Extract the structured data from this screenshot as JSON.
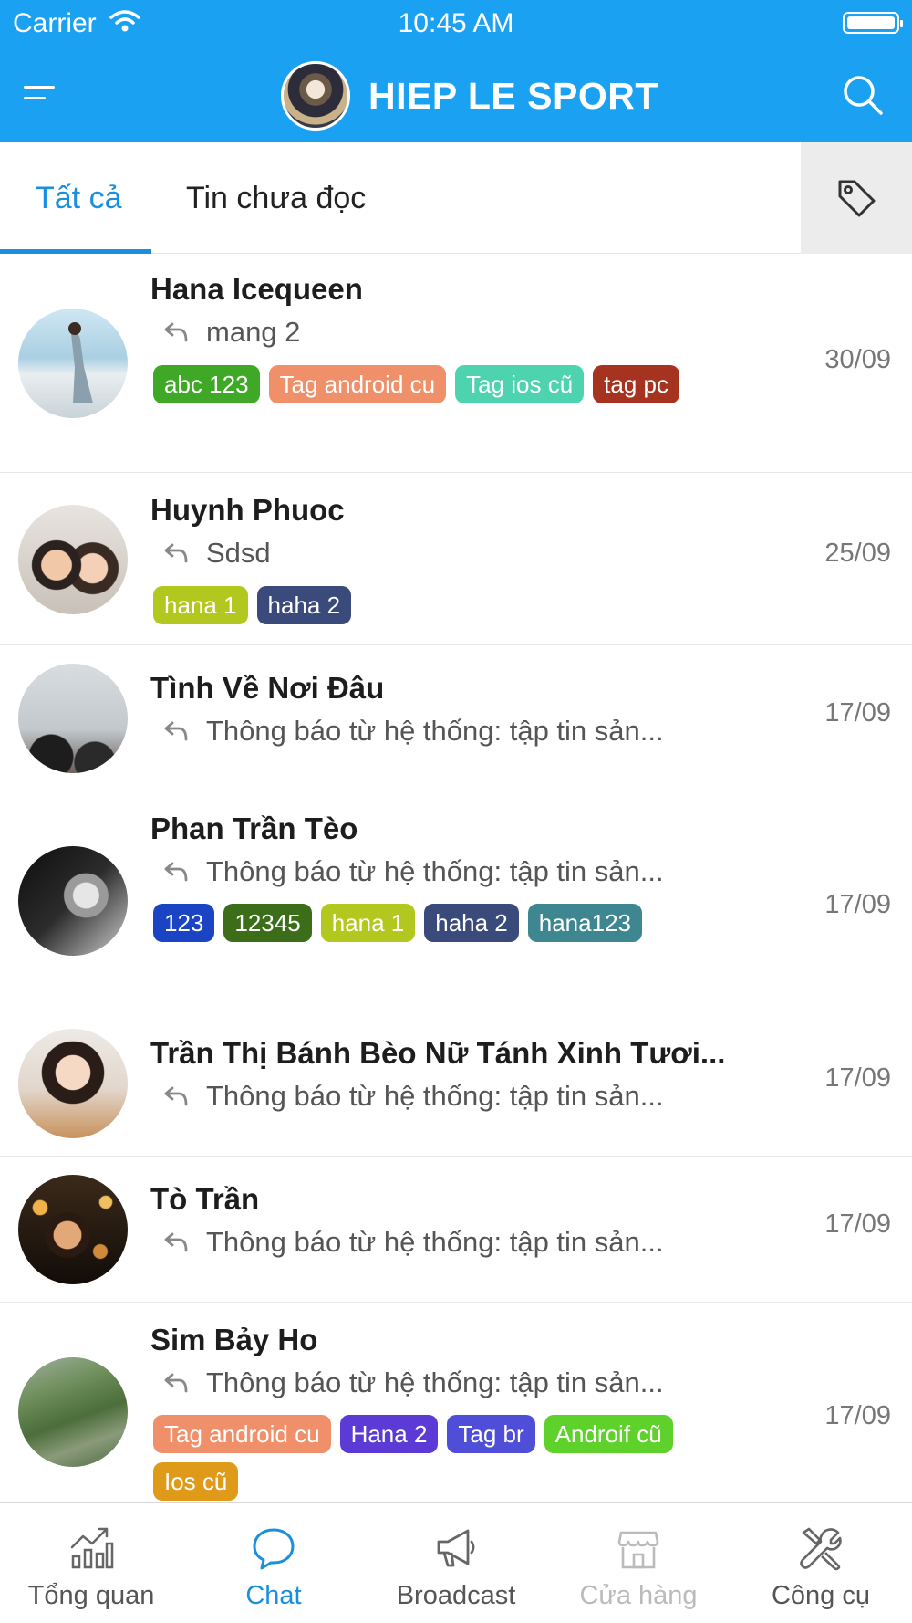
{
  "status_bar": {
    "carrier": "Carrier",
    "time": "10:45 AM"
  },
  "header": {
    "title": "HIEP LE SPORT"
  },
  "tabs": [
    {
      "label": "Tất cả",
      "active": true
    },
    {
      "label": "Tin chưa đọc",
      "active": false
    }
  ],
  "conversations": [
    {
      "name": "Hana Icequeen",
      "preview": "mang 2",
      "date": "30/09",
      "tags": [
        {
          "label": "abc 123",
          "color": "#3fa827"
        },
        {
          "label": "Tag android cu",
          "color": "#f0906a"
        },
        {
          "label": "Tag ios cũ",
          "color": "#4dd3b0"
        },
        {
          "label": "tag pc",
          "color": "#a5331f"
        }
      ]
    },
    {
      "name": "Huynh Phuoc",
      "preview": "Sdsd",
      "date": "25/09",
      "tags": [
        {
          "label": "hana 1",
          "color": "#b2c81e"
        },
        {
          "label": "haha 2",
          "color": "#3a4a7a"
        }
      ]
    },
    {
      "name": "Tình Về Nơi Đâu",
      "preview": "Thông báo từ hệ thống: tập tin sản...",
      "date": "17/09",
      "tags": []
    },
    {
      "name": "Phan Trần Tèo",
      "preview": "Thông báo từ hệ thống: tập tin sản...",
      "date": "17/09",
      "tags": [
        {
          "label": "123",
          "color": "#1a44c4"
        },
        {
          "label": "12345",
          "color": "#3c6e1a"
        },
        {
          "label": "hana 1",
          "color": "#b2c81e"
        },
        {
          "label": "haha 2",
          "color": "#3a4a7a"
        },
        {
          "label": "hana123",
          "color": "#3f8790"
        }
      ]
    },
    {
      "name": "Trần Thị Bánh Bèo Nữ Tánh Xinh Tươi...",
      "preview": "Thông báo từ hệ thống: tập tin sản...",
      "date": "17/09",
      "tags": []
    },
    {
      "name": "Tò Trần",
      "preview": "Thông báo từ hệ thống: tập tin sản...",
      "date": "17/09",
      "tags": []
    },
    {
      "name": "Sim Bảy Ho",
      "preview": "Thông báo từ hệ thống: tập tin sản...",
      "date": "17/09",
      "tags": [
        {
          "label": "Tag android cu",
          "color": "#f0906a"
        },
        {
          "label": "Hana 2",
          "color": "#5b3ad6"
        },
        {
          "label": "Tag br",
          "color": "#4e4ed8"
        },
        {
          "label": "Androif cũ",
          "color": "#5ed12a"
        },
        {
          "label": "Ios cũ",
          "color": "#e09a1a"
        }
      ]
    }
  ],
  "bottom_nav": [
    {
      "label": "Tổng quan",
      "icon": "chart-icon",
      "state": "normal"
    },
    {
      "label": "Chat",
      "icon": "chat-bubble-icon",
      "state": "active"
    },
    {
      "label": "Broadcast",
      "icon": "megaphone-icon",
      "state": "normal"
    },
    {
      "label": "Cửa hàng",
      "icon": "store-icon",
      "state": "disabled"
    },
    {
      "label": "Công cụ",
      "icon": "tools-icon",
      "state": "normal"
    }
  ]
}
